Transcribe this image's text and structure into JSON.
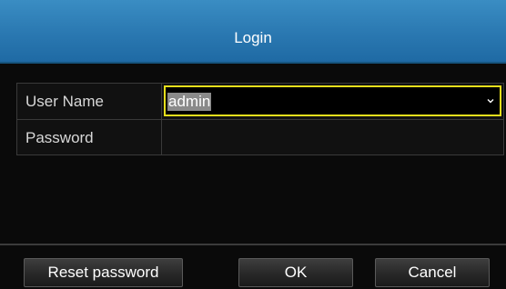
{
  "dialog": {
    "title": "Login"
  },
  "form": {
    "user_name_label": "User Name",
    "user_name_value": "admin",
    "password_label": "Password",
    "password_value": ""
  },
  "buttons": {
    "reset_password": "Reset password",
    "ok": "OK",
    "cancel": "Cancel"
  },
  "colors": {
    "title_bar": "#2a78b1",
    "body_background": "#0a0a0a",
    "focus_outline": "#e6df1c"
  },
  "icons": {
    "dropdown": "chevron-down-icon"
  }
}
